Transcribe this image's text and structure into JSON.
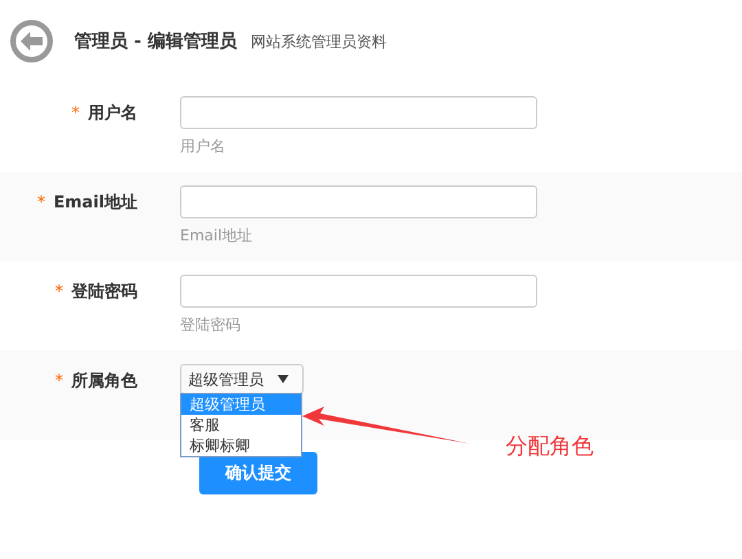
{
  "header": {
    "title": "管理员 - 编辑管理员",
    "subtitle": "网站系统管理员资料"
  },
  "fields": [
    {
      "kind": "text",
      "required_mark": "*",
      "label": "用户名",
      "hint": "用户名"
    },
    {
      "kind": "text",
      "required_mark": "*",
      "label": "Email地址",
      "hint": "Email地址"
    },
    {
      "kind": "text",
      "required_mark": "*",
      "label": "登陆密码",
      "hint": "登陆密码"
    },
    {
      "kind": "select",
      "required_mark": "*",
      "label": "所属角色",
      "value": "超级管理员",
      "options": [
        {
          "label": "超级管理员",
          "selected": true
        },
        {
          "label": "客服",
          "selected": false
        },
        {
          "label": "标卿标卿",
          "selected": false
        }
      ]
    }
  ],
  "submit": "确认提交",
  "annotation": "分配角色"
}
